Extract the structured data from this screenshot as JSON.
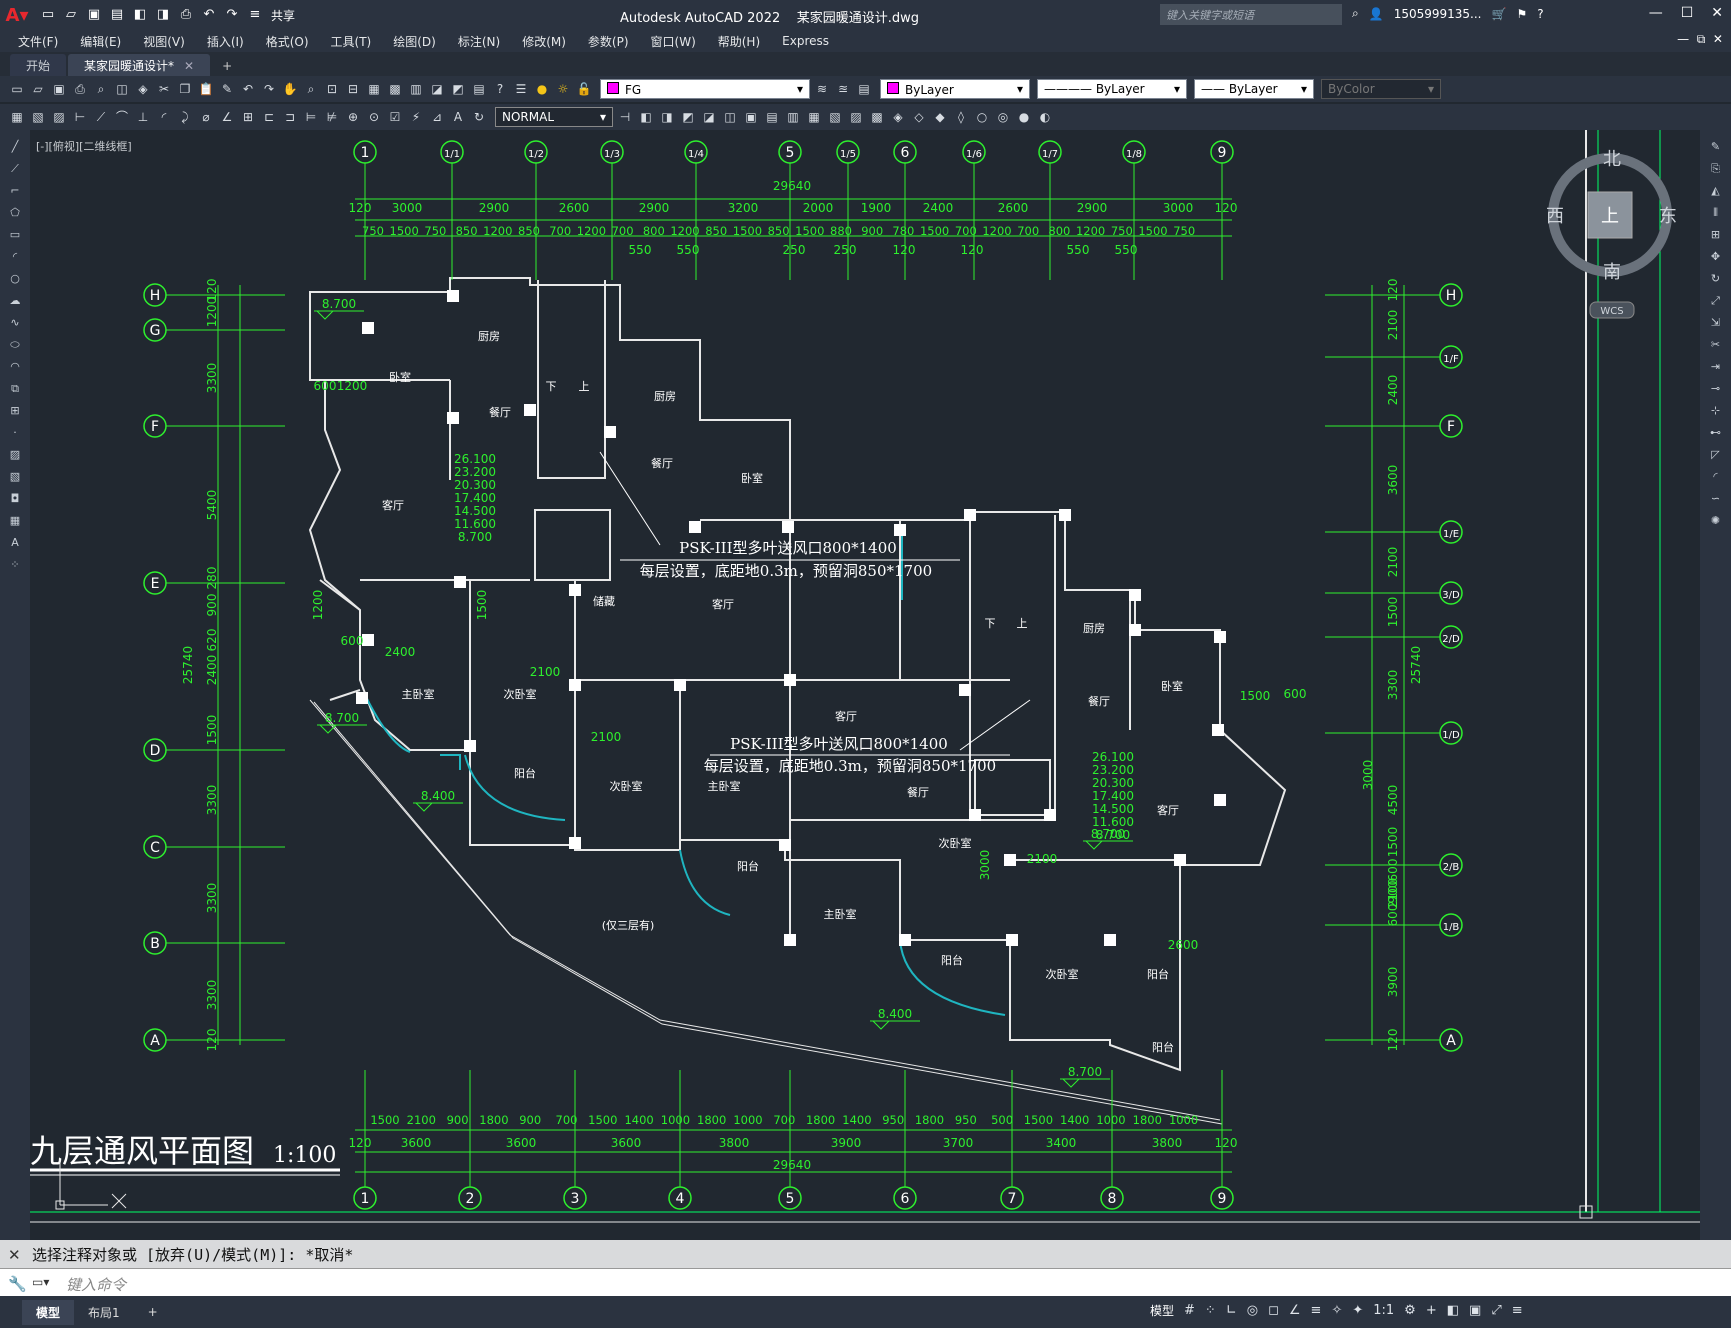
{
  "app": {
    "title": "Autodesk AutoCAD 2022",
    "file": "某家园暖通设计.dwg",
    "share": "共享",
    "search_placeholder": "键入关键字或短语",
    "user": "1505999135..."
  },
  "menu": [
    "文件(F)",
    "编辑(E)",
    "视图(V)",
    "插入(I)",
    "格式(O)",
    "工具(T)",
    "绘图(D)",
    "标注(N)",
    "修改(M)",
    "参数(P)",
    "窗口(W)",
    "帮助(H)",
    "Express"
  ],
  "tabs": {
    "start": "开始",
    "active": "某家园暖通设计*"
  },
  "props": {
    "layer": "FG",
    "color": "ByLayer",
    "linetype": "ByLayer",
    "lineweight": "ByLayer",
    "plotstyle": "ByColor",
    "dimstyle": "NORMAL"
  },
  "view_label": "[-][俯视][二维线框]",
  "viewcube": {
    "n": "北",
    "s": "南",
    "e": "东",
    "w": "西",
    "top": "上",
    "wcs": "WCS"
  },
  "drawing": {
    "title": "九层通风平面图",
    "scale": "1:100",
    "total": "29640",
    "total_height": "25740",
    "top_axes": [
      "1",
      "1/1",
      "1/2",
      "1/3",
      "1/4",
      "5",
      "1/5",
      "6",
      "1/6",
      "1/7",
      "1/8",
      "9"
    ],
    "bottom_axes": [
      "1",
      "2",
      "3",
      "4",
      "5",
      "6",
      "7",
      "8",
      "9"
    ],
    "left_axes": [
      "H",
      "G",
      "F",
      "E",
      "D",
      "C",
      "B",
      "A"
    ],
    "right_axes": [
      "H",
      "1/F",
      "F",
      "1/E",
      "3/D",
      "2/D",
      "1/D",
      "2/B",
      "1/B",
      "A"
    ],
    "top_dims1": [
      "120",
      "3000",
      "2900",
      "2600",
      "2900",
      "3200",
      "2000",
      "1900",
      "2400",
      "2600",
      "2900",
      "3000",
      "120"
    ],
    "top_dims2": [
      "750",
      "1500",
      "750",
      "850",
      "1200",
      "850",
      "700",
      "1200",
      "700",
      "800",
      "1200",
      "850",
      "1500",
      "850",
      "1500",
      "880",
      "900",
      "780",
      "1500",
      "700",
      "1200",
      "700",
      "800",
      "1200",
      "750",
      "1500",
      "750"
    ],
    "top_dims3": [
      "550",
      "550",
      "250",
      "250",
      "120",
      "120",
      "550",
      "550"
    ],
    "bottom_dims1": [
      "1500",
      "2100",
      "900",
      "1800",
      "900",
      "700",
      "1500",
      "1400",
      "1000",
      "1800",
      "1000",
      "700",
      "1800",
      "1400",
      "950",
      "1800",
      "950",
      "500",
      "1500",
      "1400",
      "1000",
      "1800",
      "1000"
    ],
    "bottom_dims2": [
      "120",
      "3600",
      "3600",
      "3600",
      "3800",
      "3900",
      "3700",
      "3400",
      "3800",
      "120"
    ],
    "left_dims": [
      "120",
      "1200",
      "3300",
      "5400",
      "280",
      "900",
      "620",
      "2400",
      "1500",
      "3300",
      "3300",
      "3300",
      "120"
    ],
    "right_dims": [
      "120",
      "2100",
      "2400",
      "3600",
      "2100",
      "1500",
      "3300",
      "3000",
      "4500",
      "1500",
      "600",
      "900",
      "2100",
      "600",
      "3900",
      "120"
    ],
    "rooms": [
      "厨房",
      "卧室",
      "餐厅",
      "客厅",
      "厨房",
      "餐厅",
      "卧室",
      "储藏",
      "客厅",
      "主卧室",
      "次卧室",
      "阳台",
      "次卧室",
      "主卧室",
      "阳台",
      "客厅",
      "餐厅",
      "阳台",
      "厨房",
      "餐厅",
      "卧室",
      "客厅",
      "次卧室",
      "主卧室",
      "次卧室",
      "阳台",
      "阳台",
      "下",
      "上",
      "下",
      "上"
    ],
    "elev": [
      "8.700",
      "8.700",
      "8.400",
      "8.400",
      "8.700",
      "8.700"
    ],
    "levels": [
      "26.100",
      "23.200",
      "20.300",
      "17.400",
      "14.500",
      "11.600",
      "8.700"
    ],
    "note1": "PSK-III型多叶送风口800*1400",
    "note2": "每层设置，底距地0.3m，预留洞850*1700",
    "note3": "(仅三层有)",
    "misc_dims": [
      "600",
      "1200",
      "1200",
      "1500",
      "600",
      "2400",
      "2100",
      "2100",
      "1500",
      "600",
      "2100",
      "3000",
      "2600"
    ]
  },
  "cmd": {
    "history": "选择注释对象或 [放弃(U)/模式(M)]: *取消*",
    "placeholder": "键入命令"
  },
  "layouts": [
    "模型",
    "布局1"
  ],
  "status": {
    "model": "模型",
    "scale": "1:1"
  }
}
